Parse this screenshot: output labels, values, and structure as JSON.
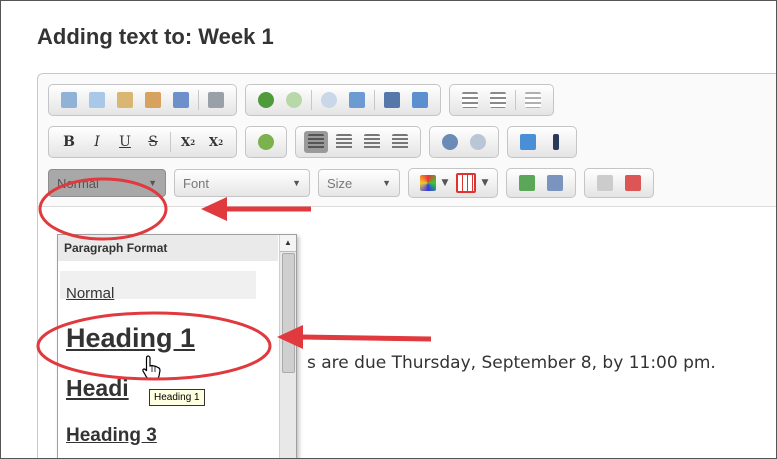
{
  "page": {
    "title": "Adding text to: Week 1"
  },
  "toolbar": {
    "row2_text_buttons": [
      "B",
      "I",
      "U",
      "S",
      "X",
      "X"
    ],
    "subscript_mark": "2",
    "superscript_mark": "2"
  },
  "combos": {
    "format": "Normal",
    "font": "Font",
    "size": "Size"
  },
  "format_panel": {
    "header": "Paragraph Format",
    "items": [
      "Normal",
      "Heading 1",
      "Headi",
      "Heading 3"
    ]
  },
  "tooltip": "Heading 1",
  "content": {
    "text": "s are due Thursday, September 8, by 11:00 pm."
  },
  "colors": {
    "annotation": "#e0393e",
    "toolbar_border": "#c5c5c5"
  }
}
